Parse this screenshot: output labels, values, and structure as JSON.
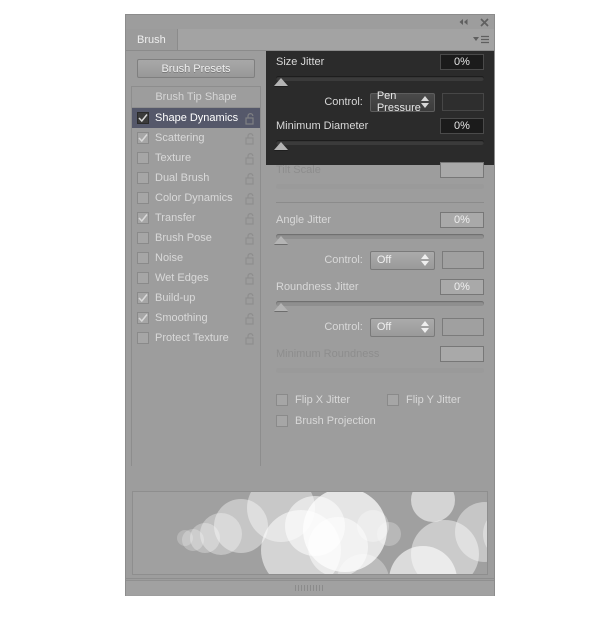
{
  "window": {
    "title": "Brush",
    "collapse_icon": "collapse-icon",
    "close_icon": "close-icon",
    "menu_icon": "panel-menu-icon"
  },
  "tabs": [
    {
      "label": "Brush",
      "active": true
    }
  ],
  "left_panel": {
    "presets_button": "Brush Presets",
    "list_header": "Brush Tip Shape",
    "items": [
      {
        "label": "Shape Dynamics",
        "checked": true,
        "selected": true,
        "locked": false
      },
      {
        "label": "Scattering",
        "checked": true,
        "selected": false,
        "locked": false
      },
      {
        "label": "Texture",
        "checked": false,
        "selected": false,
        "locked": false
      },
      {
        "label": "Dual Brush",
        "checked": false,
        "selected": false,
        "locked": false
      },
      {
        "label": "Color Dynamics",
        "checked": false,
        "selected": false,
        "locked": false
      },
      {
        "label": "Transfer",
        "checked": true,
        "selected": false,
        "locked": false
      },
      {
        "label": "Brush Pose",
        "checked": false,
        "selected": false,
        "locked": false
      },
      {
        "label": "Noise",
        "checked": false,
        "selected": false,
        "locked": false
      },
      {
        "label": "Wet Edges",
        "checked": false,
        "selected": false,
        "locked": false
      },
      {
        "label": "Build-up",
        "checked": true,
        "selected": false,
        "locked": false
      },
      {
        "label": "Smoothing",
        "checked": true,
        "selected": false,
        "locked": false
      },
      {
        "label": "Protect Texture",
        "checked": false,
        "selected": false,
        "locked": false
      }
    ]
  },
  "options": {
    "size_jitter": {
      "label": "Size Jitter",
      "value": "0%",
      "slider_pct": 0
    },
    "size_control": {
      "label": "Control:",
      "value": "Pen Pressure"
    },
    "minimum_diameter": {
      "label": "Minimum Diameter",
      "value": "0%",
      "slider_pct": 0
    },
    "tilt_scale": {
      "label": "Tilt Scale",
      "value": "",
      "slider_pct": 0,
      "disabled": true
    },
    "angle_jitter": {
      "label": "Angle Jitter",
      "value": "0%",
      "slider_pct": 0
    },
    "angle_control": {
      "label": "Control:",
      "value": "Off"
    },
    "roundness_jitter": {
      "label": "Roundness Jitter",
      "value": "0%",
      "slider_pct": 0
    },
    "roundness_control": {
      "label": "Control:",
      "value": "Off"
    },
    "minimum_roundness": {
      "label": "Minimum Roundness",
      "value": "",
      "slider_pct": 0,
      "disabled": true
    },
    "flip_x_jitter": {
      "label": "Flip X Jitter",
      "checked": false
    },
    "flip_y_jitter": {
      "label": "Flip Y Jitter",
      "checked": false
    },
    "brush_projection": {
      "label": "Brush Projection",
      "checked": false
    }
  },
  "bottom_toolbar": {
    "icons": [
      "toggle-brush-settings-icon",
      "new-brush-preset-icon",
      "create-new-brush-icon"
    ]
  },
  "colors": {
    "panel_bg": "#9d9d9d",
    "dark_zone": "#2b2b2b",
    "selection": "#55586a",
    "text": "#d8d8d8",
    "text_dim": "#8d8d8d"
  }
}
